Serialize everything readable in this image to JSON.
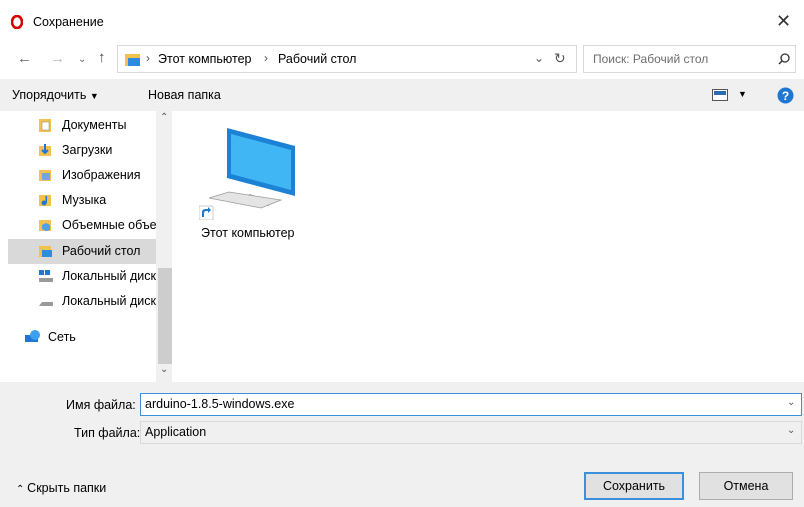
{
  "window": {
    "title": "Сохранение",
    "close_icon": "close-icon"
  },
  "address": {
    "segments": [
      "Этот компьютер",
      "Рабочий стол"
    ],
    "search_placeholder": "Поиск: Рабочий стол"
  },
  "toolbar": {
    "organize": "Упорядочить",
    "new_folder": "Новая папка"
  },
  "sidebar": {
    "items": [
      {
        "label": "Документы",
        "icon": "documents-folder-icon"
      },
      {
        "label": "Загрузки",
        "icon": "downloads-folder-icon"
      },
      {
        "label": "Изображения",
        "icon": "pictures-folder-icon"
      },
      {
        "label": "Музыка",
        "icon": "music-folder-icon"
      },
      {
        "label": "Объемные объекты",
        "icon": "3d-objects-folder-icon"
      },
      {
        "label": "Рабочий стол",
        "icon": "desktop-folder-icon",
        "selected": true
      },
      {
        "label": "Локальный диск (C:)",
        "icon": "local-disk-icon"
      },
      {
        "label": "Локальный диск (D:)",
        "icon": "local-disk-icon"
      },
      {
        "label": "Сеть",
        "icon": "network-icon"
      }
    ]
  },
  "content": {
    "items": [
      {
        "label": "Этот компьютер",
        "icon": "computer-icon"
      }
    ]
  },
  "form": {
    "filename_label": "Имя файла:",
    "filename_value": "arduino-1.8.5-windows.exe",
    "filetype_label": "Тип файла:",
    "filetype_value": "Application"
  },
  "footer": {
    "hide_folders": "Скрыть папки",
    "save": "Сохранить",
    "cancel": "Отмена"
  },
  "colors": {
    "accent": "#3c8fd9",
    "opera_red": "#d50000",
    "help_blue": "#1e78d2"
  }
}
